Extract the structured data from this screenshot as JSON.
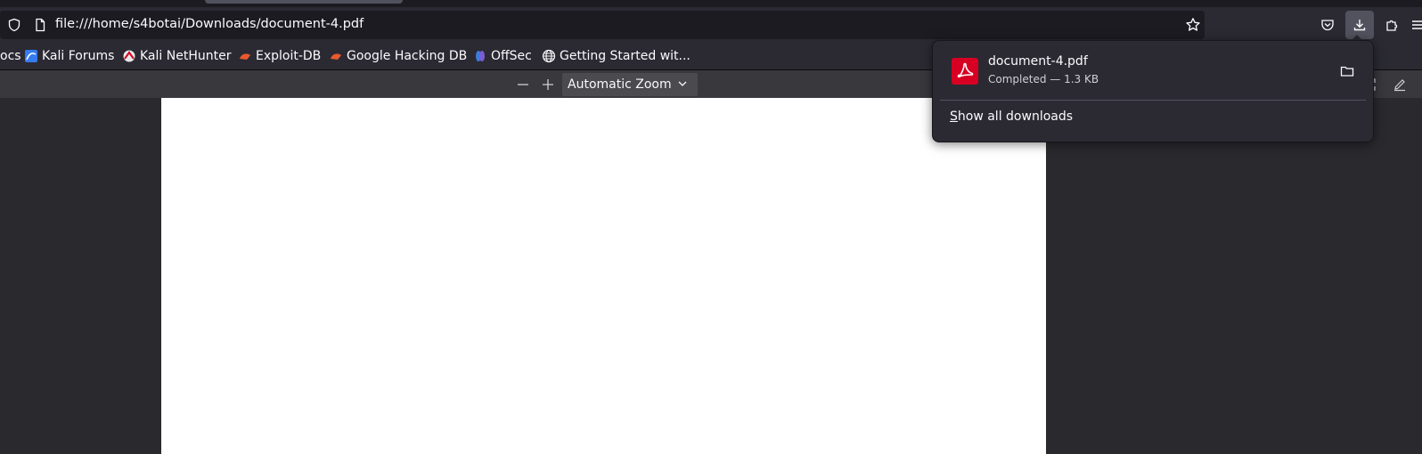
{
  "navbar": {
    "url": "file:///home/s4botai/Downloads/document-4.pdf"
  },
  "bookmarks": [
    {
      "label": "ocs",
      "icon": "none"
    },
    {
      "label": "Kali Forums",
      "icon": "kali-forums-icon"
    },
    {
      "label": "Kali NetHunter",
      "icon": "nethunter-icon"
    },
    {
      "label": "Exploit-DB",
      "icon": "exploit-db-icon"
    },
    {
      "label": "Google Hacking DB",
      "icon": "ghdb-icon"
    },
    {
      "label": "OffSec",
      "icon": "offsec-icon"
    },
    {
      "label": "Getting Started wit...",
      "icon": "globe-icon"
    }
  ],
  "pdf_toolbar": {
    "zoom_out": "—",
    "zoom_in": "+",
    "zoom_value": "Automatic Zoom"
  },
  "downloads": {
    "item": {
      "filename": "document-4.pdf",
      "status": "Completed — 1.3 KB"
    },
    "show_all": "Show all downloads"
  },
  "colors": {
    "accent_active": "#52525e",
    "pdf_red": "#d70022"
  }
}
